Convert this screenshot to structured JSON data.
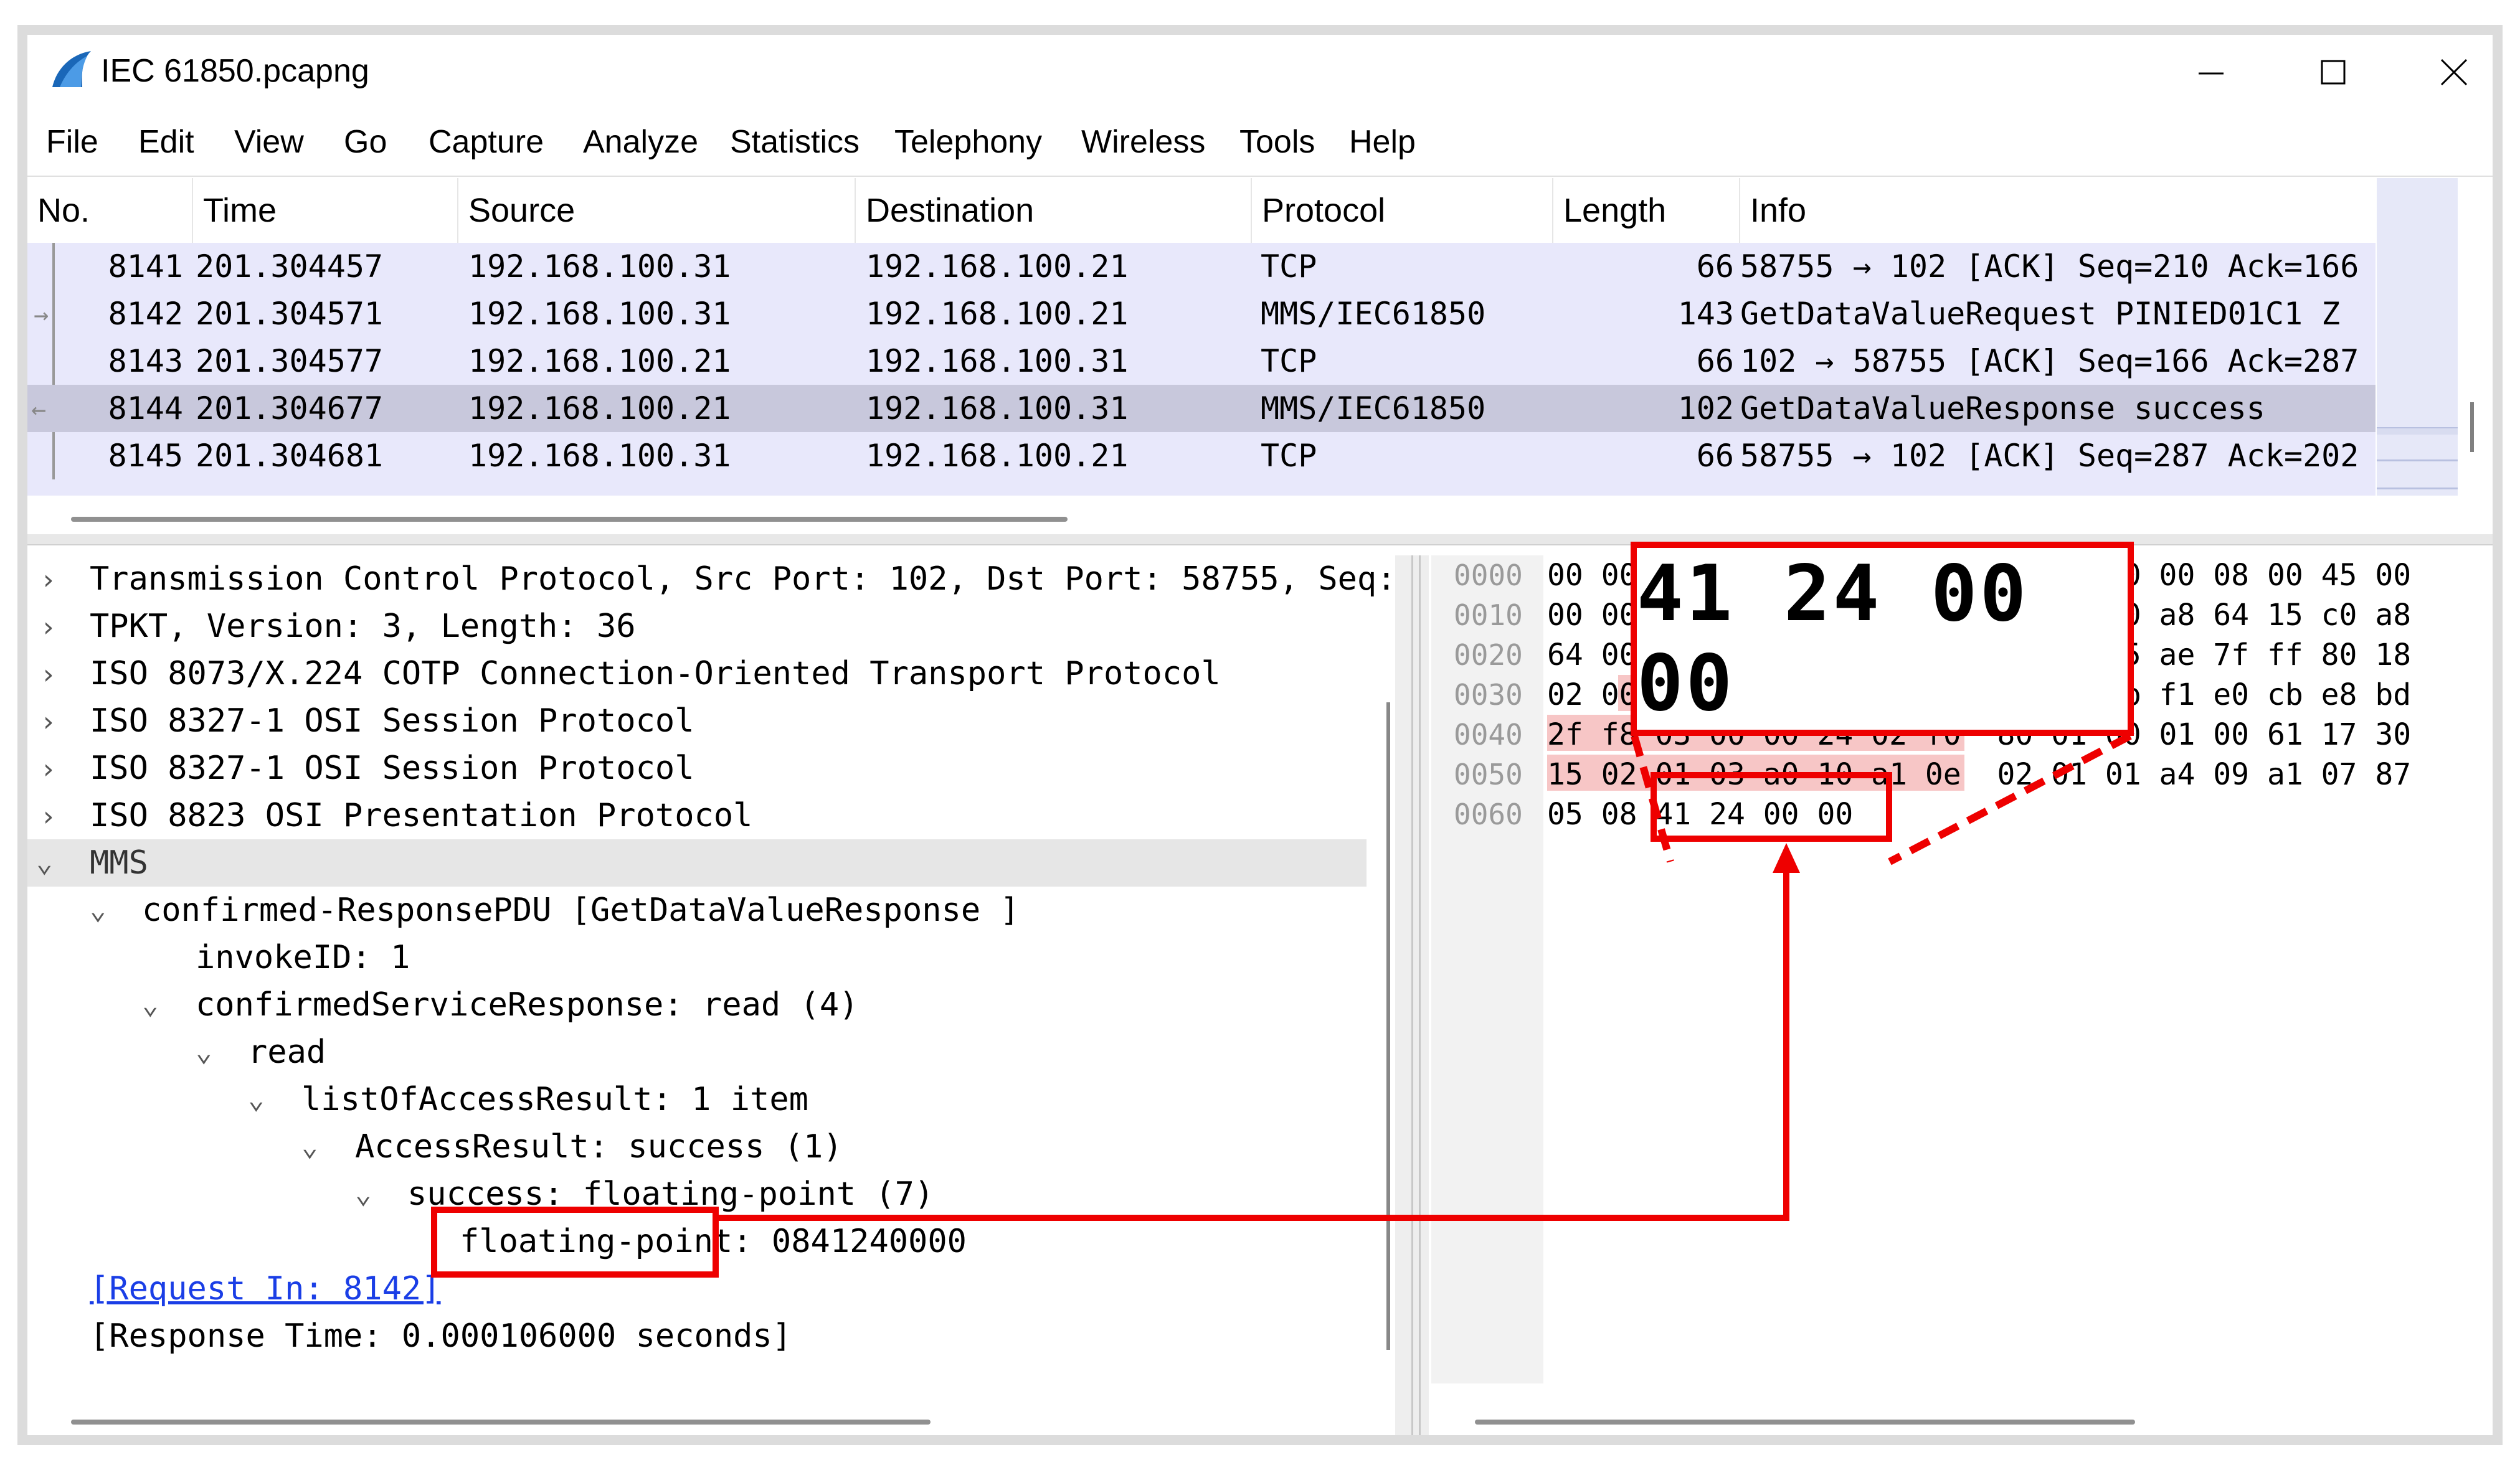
{
  "window": {
    "title": "IEC 61850.pcapng",
    "buttons": {
      "minimize": "–",
      "maximize": "☐",
      "close": "✕"
    }
  },
  "menu": [
    "File",
    "Edit",
    "View",
    "Go",
    "Capture",
    "Analyze",
    "Statistics",
    "Telephony",
    "Wireless",
    "Tools",
    "Help"
  ],
  "packet_list": {
    "columns": [
      "No.",
      "Time",
      "Source",
      "Destination",
      "Protocol",
      "Length",
      "Info"
    ],
    "rows": [
      {
        "no": "8141",
        "time": "201.304457",
        "src": "192.168.100.31",
        "dst": "192.168.100.21",
        "proto": "TCP",
        "len": "66",
        "info": "58755 → 102 [ACK] Seq=210 Ack=166"
      },
      {
        "no": "8142",
        "time": "201.304571",
        "src": "192.168.100.31",
        "dst": "192.168.100.21",
        "proto": "MMS/IEC61850",
        "len": "143",
        "info": "GetDataValueRequest  PINIED01C1 Z"
      },
      {
        "no": "8143",
        "time": "201.304577",
        "src": "192.168.100.21",
        "dst": "192.168.100.31",
        "proto": "TCP",
        "len": "66",
        "info": "102 → 58755 [ACK] Seq=166 Ack=287"
      },
      {
        "no": "8144",
        "time": "201.304677",
        "src": "192.168.100.21",
        "dst": "192.168.100.31",
        "proto": "MMS/IEC61850",
        "len": "102",
        "info": "GetDataValueResponse success"
      },
      {
        "no": "8145",
        "time": "201.304681",
        "src": "192.168.100.31",
        "dst": "192.168.100.21",
        "proto": "TCP",
        "len": "66",
        "info": "58755 → 102 [ACK] Seq=287 Ack=202"
      }
    ]
  },
  "tree": {
    "items": [
      "Transmission Control Protocol, Src Port: 102, Dst Port: 58755, Seq:",
      "TPKT, Version: 3, Length: 36",
      "ISO 8073/X.224 COTP Connection-Oriented Transport Protocol",
      "ISO 8327-1 OSI Session Protocol",
      "ISO 8327-1 OSI Session Protocol",
      "ISO 8823 OSI Presentation Protocol",
      "MMS",
      "confirmed-ResponsePDU [GetDataValueResponse ]",
      "invokeID: 1",
      "confirmedServiceResponse: read (4)",
      "read",
      "listOfAccessResult: 1 item",
      "AccessResult: success (1)",
      "success: floating-point (7)",
      "floating-point: 0841240000",
      "[Request In: 8142]",
      "[Response Time: 0.000106000 seconds]"
    ]
  },
  "hex": {
    "offsets": [
      "0000",
      "0010",
      "0020",
      "0030",
      "0040",
      "0050",
      "0060"
    ],
    "lines": [
      "00 00 00 00 00 00 00 00  00 00 00 00 08 00 45 00",
      "00 00 00 00 00 00 00 00  00 00 c0 a8 64 15 c0 a8",
      "64 00 00 00 00 00 00 00  00 00 65 ae 7f ff 80 18",
      "02 00 49 d0 00 00 01 01  08 0a cb f1 e0 cb e8 bd",
      "2f f8 03 00 00 24 02 f0  80 01 00 01 00 61 17 30",
      "15 02 01 03 a0 10 a1 0e  02 01 01 a4 09 a1 07 87",
      "05 08 41 24 00 00"
    ],
    "zoom_label": "41 24 00 00"
  }
}
